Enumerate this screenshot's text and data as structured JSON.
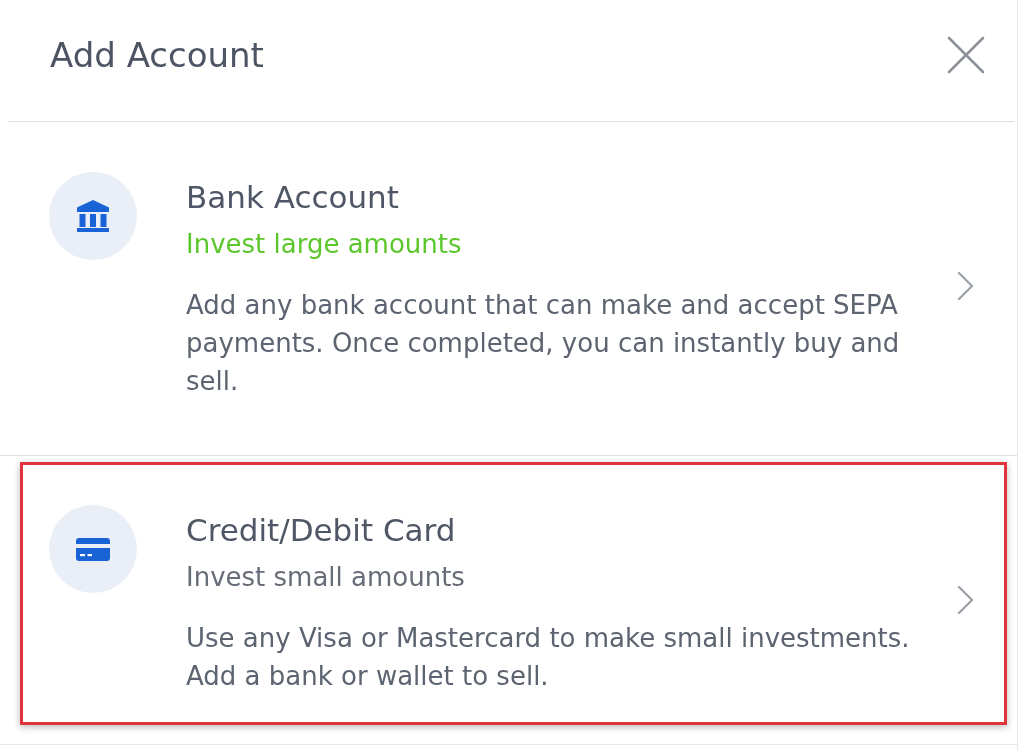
{
  "header": {
    "title": "Add Account"
  },
  "options": [
    {
      "kind": "bank",
      "title": "Bank Account",
      "subtitle": "Invest large amounts",
      "color": "#5cc72c",
      "description": "Add any bank account that can make and accept SEPA payments. Once completed, you can instantly buy and sell.",
      "highlighted": false
    },
    {
      "kind": "card",
      "title": "Credit/Debit Card",
      "subtitle": "Invest small amounts",
      "color": "#676d78",
      "description": "Use any Visa or Mastercard to make small investments. Add a bank or wallet to sell.",
      "highlighted": true
    }
  ]
}
